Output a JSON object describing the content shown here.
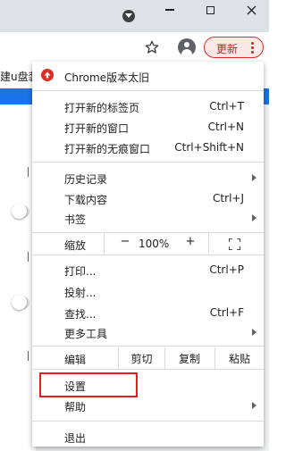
{
  "bookmark_bar": {
    "item": "建u盘装"
  },
  "toolbar": {
    "update_label": "更新"
  },
  "menu": {
    "update_notice": "Chrome版本太旧",
    "new_tab": {
      "label": "打开新的标签页",
      "shortcut": "Ctrl+T"
    },
    "new_window": {
      "label": "打开新的窗口",
      "shortcut": "Ctrl+N"
    },
    "new_incognito": {
      "label": "打开新的无痕窗口",
      "shortcut": "Ctrl+Shift+N"
    },
    "history": {
      "label": "历史记录"
    },
    "downloads": {
      "label": "下载内容",
      "shortcut": "Ctrl+J"
    },
    "bookmarks": {
      "label": "书签"
    },
    "zoom": {
      "label": "缩放",
      "minus": "−",
      "value": "100%",
      "plus": "+"
    },
    "print": {
      "label": "打印...",
      "shortcut": "Ctrl+P"
    },
    "cast": {
      "label": "投射..."
    },
    "find": {
      "label": "查找...",
      "shortcut": "Ctrl+F"
    },
    "more_tools": {
      "label": "更多工具"
    },
    "edit": {
      "label": "编辑",
      "cut": "剪切",
      "copy": "复制",
      "paste": "粘贴"
    },
    "settings": {
      "label": "设置"
    },
    "help": {
      "label": "帮助"
    },
    "exit": {
      "label": "退出"
    }
  },
  "colors": {
    "update_accent": "#d93025",
    "highlight_box": "#e02020",
    "page_header": "#1a73e8"
  }
}
